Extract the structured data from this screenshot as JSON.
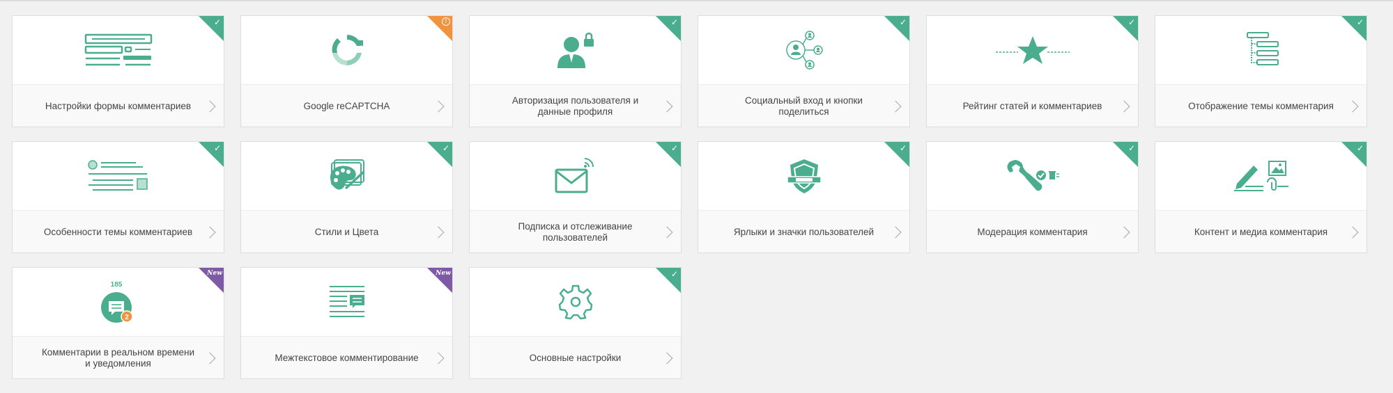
{
  "colors": {
    "accent": "#4aae8e",
    "warning": "#f0923e",
    "new": "#7e5aa6",
    "background": "#f1f1f1"
  },
  "cards": [
    {
      "title": "Настройки формы комментариев",
      "icon": "form-settings-icon",
      "badge": "check"
    },
    {
      "title": "Google reCAPTCHA",
      "icon": "recaptcha-icon",
      "badge": "warning"
    },
    {
      "title": "Авторизация пользователя и данные профиля",
      "icon": "user-lock-icon",
      "badge": "check"
    },
    {
      "title": "Социальный вход и кнопки поделиться",
      "icon": "social-network-icon",
      "badge": "check"
    },
    {
      "title": "Рейтинг статей и комментариев",
      "icon": "star-rating-icon",
      "badge": "check"
    },
    {
      "title": "Отображение темы комментария",
      "icon": "thread-display-icon",
      "badge": "check"
    },
    {
      "title": "Особенности темы комментариев",
      "icon": "thread-features-icon",
      "badge": "check"
    },
    {
      "title": "Стили и Цвета",
      "icon": "palette-icon",
      "badge": "check"
    },
    {
      "title": "Подписка и отслеживание пользователей",
      "icon": "envelope-icon",
      "badge": "check"
    },
    {
      "title": "Ярлыки и значки пользователей",
      "icon": "shield-badge-icon",
      "badge": "check"
    },
    {
      "title": "Модерация комментария",
      "icon": "wrench-icon",
      "badge": "check"
    },
    {
      "title": "Контент и медиа комментария",
      "icon": "media-content-icon",
      "badge": "check"
    },
    {
      "title": "Комментарии в реальном времени и уведомления",
      "icon": "realtime-bubble-icon",
      "badge": "new",
      "counter": "185",
      "bubble_count": "2"
    },
    {
      "title": "Межтекстовое комментирование",
      "icon": "inline-comment-icon",
      "badge": "new"
    },
    {
      "title": "Основные настройки",
      "icon": "gear-icon",
      "badge": "check"
    }
  ],
  "badges": {
    "check": "✓",
    "warning": "!",
    "new": "New"
  }
}
